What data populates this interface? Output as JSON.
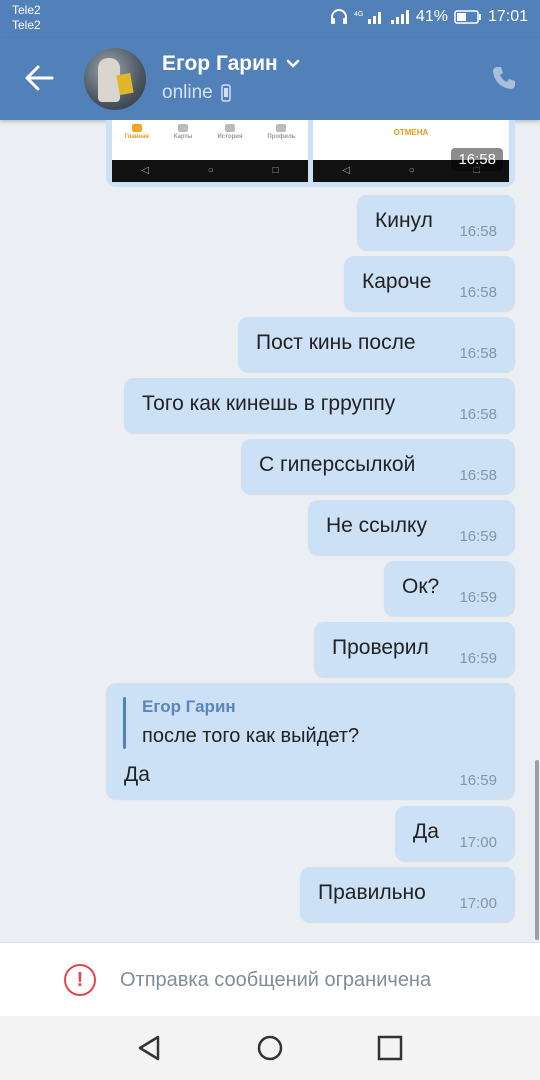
{
  "status_bar": {
    "carrier1": "Tele2",
    "carrier2": "Tele2",
    "battery": "41%",
    "time": "17:01"
  },
  "header": {
    "name": "Егор Гарин",
    "status": "online"
  },
  "shared_screenshot": {
    "tabs": [
      "Главная",
      "Карты",
      "История",
      "Профиль"
    ],
    "cancel_label": "ОТМЕНА",
    "time": "16:58"
  },
  "messages": [
    {
      "text": "Кинул",
      "time": "16:58"
    },
    {
      "text": "Кароче",
      "time": "16:58"
    },
    {
      "text": "Пост кинь после",
      "time": "16:58"
    },
    {
      "text": "Того как кинешь в грруппу",
      "time": "16:58"
    },
    {
      "text": "С гиперссылкой",
      "time": "16:58"
    },
    {
      "text": "Не ссылку",
      "time": "16:59"
    },
    {
      "text": "Ок?",
      "time": "16:59"
    },
    {
      "text": "Проверил",
      "time": "16:59"
    },
    {
      "text": "Да",
      "time": "17:00"
    },
    {
      "text": "Правильно",
      "time": "17:00"
    }
  ],
  "reply": {
    "quoted_name": "Егор Гарин",
    "quoted_text": "после того как выйдет?",
    "text": "Да",
    "time": "16:59"
  },
  "footer": {
    "restricted_text": "Отправка сообщений ограничена"
  },
  "colors": {
    "header": "#5181b8",
    "outgoing_bubble": "#cce1f6",
    "warning": "#e64646"
  }
}
